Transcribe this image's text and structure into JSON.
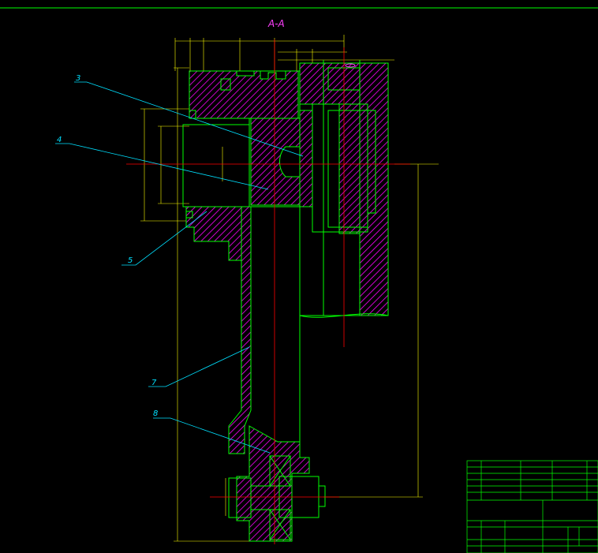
{
  "drawing": {
    "section_title": "A-A",
    "callouts": [
      "3",
      "4",
      "5",
      "7",
      "8"
    ],
    "colors": {
      "background": "#000000",
      "outline": "#00ff00",
      "centerline": "#ff0000",
      "hatch": "#ff00ff",
      "leader": "#00e0ff",
      "dimension": "#ffff00",
      "border": "#00ff00"
    }
  }
}
